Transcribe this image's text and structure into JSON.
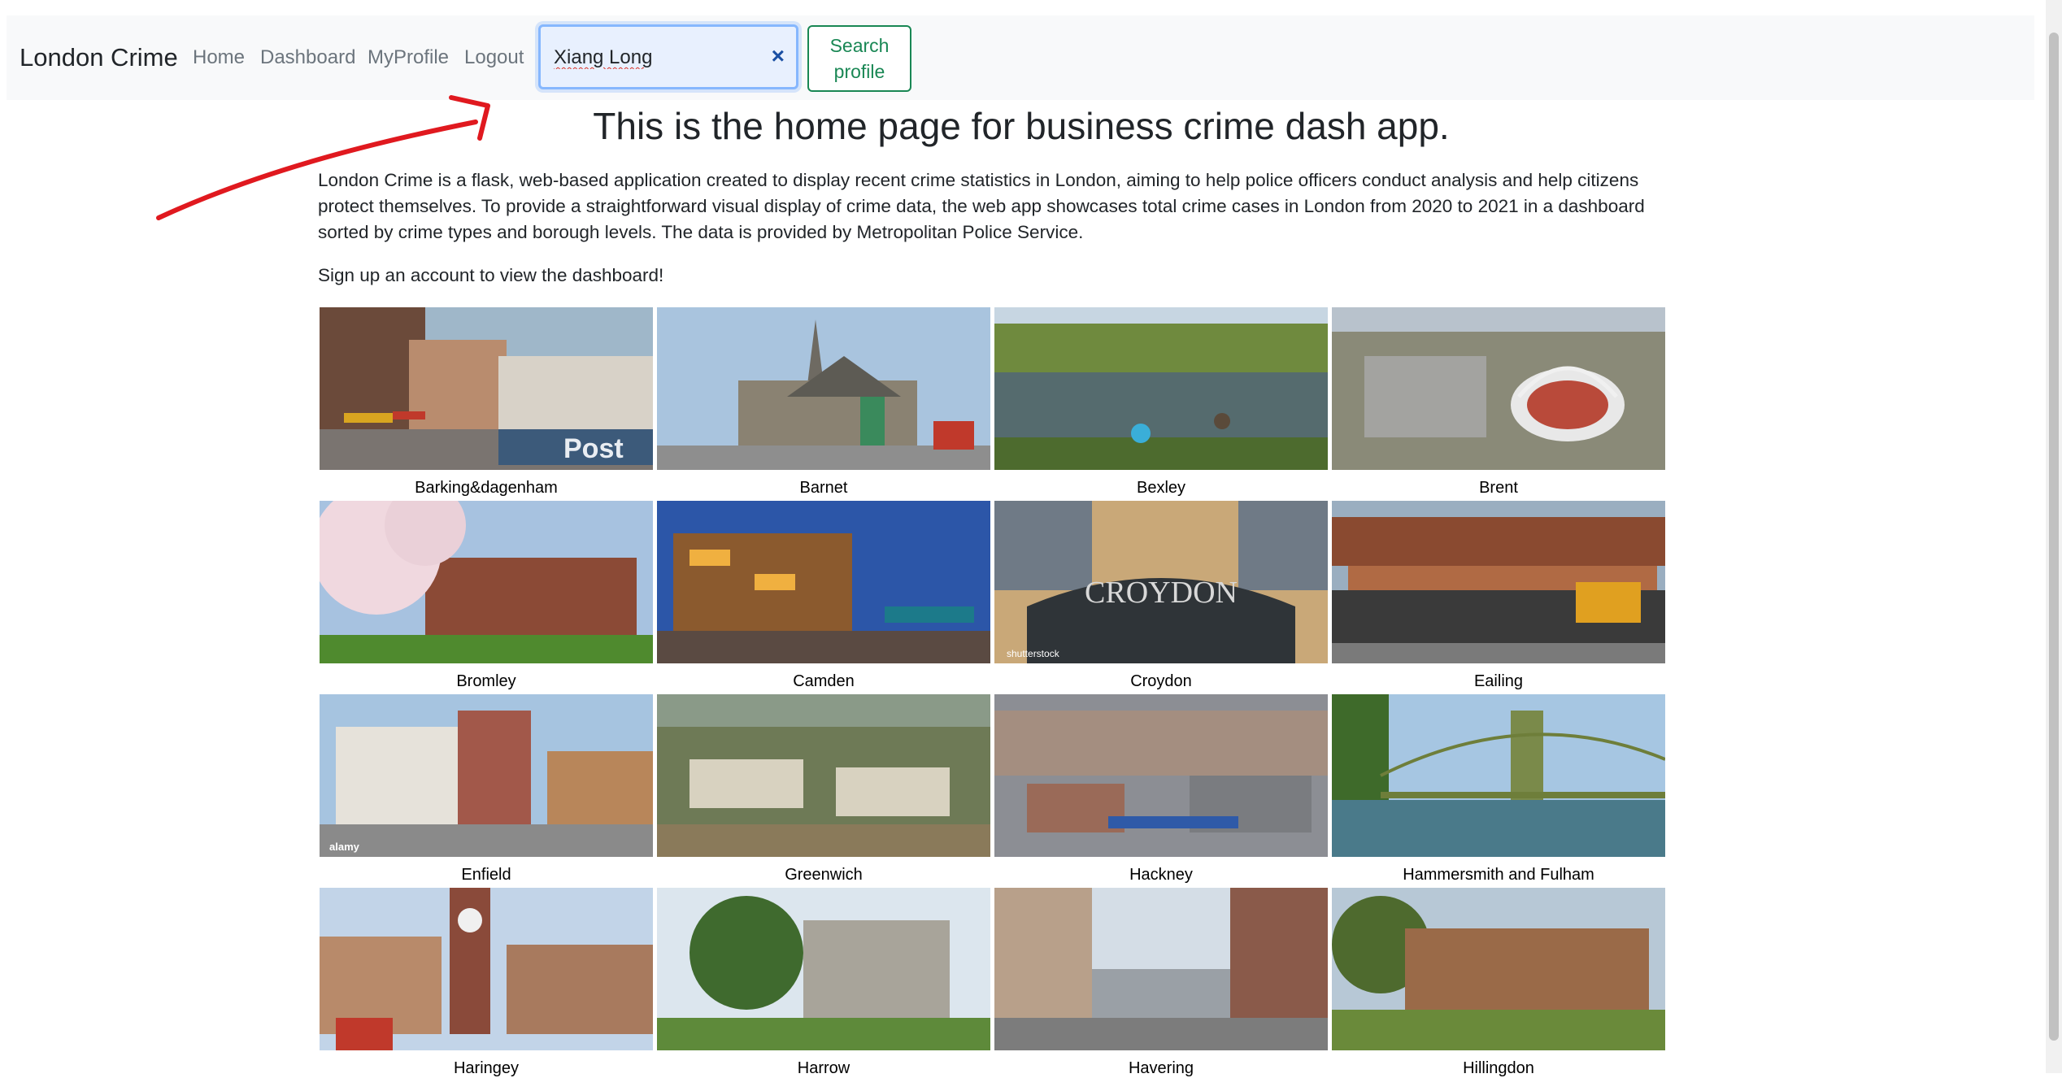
{
  "navbar": {
    "brand": "London Crime",
    "links": [
      "Home",
      "Dashboard",
      "MyProfile",
      "Logout"
    ],
    "search": {
      "value": "Xiang Long",
      "clear_icon": "×"
    },
    "search_button": "Search profile"
  },
  "main": {
    "title": "This is the home page for business crime dash app.",
    "intro": "London Crime is a flask, web-based application created to display recent crime statistics in London, aiming to help police officers conduct analysis and help citizens protect themselves. To provide a straightforward visual display of crime data, the web app showcases total crime cases in London from 2020 to 2021 in a dashboard sorted by crime types and borough levels. The data is provided by Metropolitan Police Service.",
    "signup": "Sign up an account to view the dashboard!",
    "boroughs": [
      "Barking&dagenham",
      "Barnet",
      "Bexley",
      "Brent",
      "Bromley",
      "Camden",
      "Croydon",
      "Eailing",
      "Enfield",
      "Greenwich",
      "Hackney",
      "Hammersmith and Fulham",
      "Haringey",
      "Harrow",
      "Havering",
      "Hillingdon"
    ],
    "photo_text": {
      "barking_sign": "Post",
      "croydon_sign": "CROYDON",
      "watermark_shutterstock": "shutterstock",
      "watermark_alamy": "alamy"
    }
  },
  "annotation": {
    "color": "#e0191f"
  }
}
